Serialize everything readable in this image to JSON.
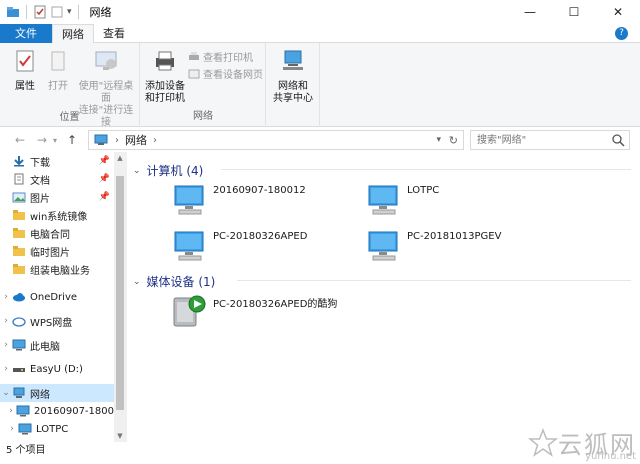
{
  "window": {
    "title": "网络",
    "controls": {
      "minimize": "—",
      "maximize": "☐",
      "close": "✕"
    }
  },
  "ribbon": {
    "tabs": [
      {
        "label": "文件"
      },
      {
        "label": "网络"
      },
      {
        "label": "查看"
      }
    ],
    "location_group": {
      "label": "位置",
      "properties": "属性",
      "open": "打开",
      "remote_line1": "使用\"远程桌面",
      "remote_line2": "连接\"进行连接"
    },
    "network_group": {
      "label": "网络",
      "add_device_line1": "添加设备",
      "add_device_line2": "和打印机",
      "view_printers": "查看打印机",
      "view_device_page": "查看设备网页",
      "share_center_line1": "网络和",
      "share_center_line2": "共享中心"
    }
  },
  "address": {
    "path": "网络",
    "search_placeholder": "搜索\"网络\""
  },
  "nav": {
    "quick_access": [
      {
        "label": "下载",
        "pinned": true
      },
      {
        "label": "文档",
        "pinned": true
      },
      {
        "label": "图片",
        "pinned": true
      },
      {
        "label": "win系统镜像",
        "pinned": false
      },
      {
        "label": "电脑合同",
        "pinned": false
      },
      {
        "label": "临时图片",
        "pinned": false
      },
      {
        "label": "组装电脑业务",
        "pinned": false
      }
    ],
    "onedrive": "OneDrive",
    "wps": "WPS网盘",
    "this_pc": "此电脑",
    "drive": "EasyU (D:)",
    "network": "网络",
    "network_children": [
      "20160907-1800",
      "LOTPC"
    ]
  },
  "content": {
    "computers_header": "计算机 (4)",
    "computers": [
      "20160907-180012",
      "LOTPC",
      "PC-20180326APED",
      "PC-20181013PGEV"
    ],
    "media_header": "媒体设备 (1)",
    "media": [
      "PC-20180326APED的酷狗"
    ]
  },
  "status": {
    "count": "5 个项目"
  },
  "watermark": {
    "text": "云狐网",
    "url": "yunhu.net"
  },
  "colors": {
    "accent": "#1979ca",
    "selected": "#cce8ff",
    "group_header": "#1e3287"
  }
}
